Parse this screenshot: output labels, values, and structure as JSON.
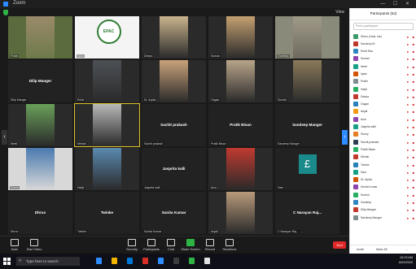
{
  "window": {
    "title": "Zoom"
  },
  "view_label": "View",
  "tiles": [
    {
      "name": "",
      "caption": "Prabh",
      "type": "video",
      "colors": [
        "#5a6b3d",
        "#9a8a6a",
        "#6e7a4a"
      ]
    },
    {
      "name": "",
      "caption": "Iqbal",
      "type": "logo",
      "logo_text": "EPAC",
      "colors": [
        "#ffffff"
      ]
    },
    {
      "name": "",
      "caption": "Deepa",
      "type": "video",
      "colors": [
        "#2a2a2a",
        "#c9b38c",
        "#2a2a2a"
      ]
    },
    {
      "name": "",
      "caption": "Suman",
      "type": "video",
      "colors": [
        "#2a2a2a",
        "#c4a070",
        "#2a2a2a"
      ]
    },
    {
      "name": "",
      "caption": "Gurdeep",
      "type": "video",
      "colors": [
        "#8a8a7a",
        "#a09a88",
        "#6e6a5e"
      ]
    },
    {
      "name": "Dilip Manger",
      "caption": "Dilip Manger",
      "type": "name"
    },
    {
      "name": "",
      "caption": "Rohit",
      "type": "video",
      "colors": [
        "#2a2a2a",
        "#4d5156",
        "#2a2a2a"
      ]
    },
    {
      "name": "",
      "caption": "Dr. Arpita",
      "type": "video",
      "colors": [
        "#2a2a2a",
        "#c9a27a",
        "#2a2a2a"
      ]
    },
    {
      "name": "",
      "caption": "Gagan",
      "type": "video",
      "colors": [
        "#2a2a2a",
        "#b9a58a",
        "#2a2a2a"
      ]
    },
    {
      "name": "",
      "caption": "Suresh",
      "type": "video",
      "colors": [
        "#2a2a2a",
        "#8a7a5a",
        "#2a2a2a"
      ]
    },
    {
      "name": "",
      "caption": "Neeti",
      "type": "video",
      "colors": [
        "#2a2a2a",
        "#6aa05a",
        "#2a2a2a"
      ]
    },
    {
      "name": "",
      "caption": "Mehak",
      "type": "video",
      "active": true,
      "colors": [
        "#2a2a2a",
        "#b8b8b8",
        "#2a2a2a"
      ]
    },
    {
      "name": "Sachit prakash",
      "caption": "Sachit prakash",
      "type": "name"
    },
    {
      "name": "Pratik Bisan",
      "caption": "Pratik Bisan",
      "type": "name"
    },
    {
      "name": "Sandeep Manger",
      "caption": "Sandeep Manger",
      "type": "name"
    },
    {
      "name": "",
      "caption": "Sunny",
      "type": "video",
      "colors": [
        "#d8d8d8",
        "#4a7ab0",
        "#d8d8d8"
      ]
    },
    {
      "name": "",
      "caption": "Harjit",
      "type": "video",
      "colors": [
        "#2a2a2a",
        "#5a8ab0",
        "#2a2a2a"
      ]
    },
    {
      "name": "Jasprita kalli",
      "caption": "Jasprita kalli",
      "type": "name"
    },
    {
      "name": "",
      "caption": "Arun",
      "type": "video",
      "colors": [
        "#2a2a2a",
        "#c03a30",
        "#2a2a2a"
      ]
    },
    {
      "name": "",
      "caption": "Sam",
      "type": "pound",
      "logo_text": "£"
    },
    {
      "name": "Dhruv",
      "caption": "Dhruv",
      "type": "name"
    },
    {
      "name": "Twinke",
      "caption": "Twinke",
      "type": "name"
    },
    {
      "name": "Sunita Kumar",
      "caption": "Sunita Kumar",
      "type": "name"
    },
    {
      "name": "",
      "caption": "Anjali",
      "type": "video",
      "colors": [
        "#2a2a2a",
        "#b89a7a",
        "#2a2a2a"
      ]
    },
    {
      "name": "C Narayan Raj...",
      "caption": "C Narayan Raj...",
      "type": "name"
    }
  ],
  "controls": [
    {
      "label": "Mute",
      "icon": "microphone-icon"
    },
    {
      "label": "Start Video",
      "icon": "video-camera-icon"
    },
    {
      "label": "Security",
      "icon": "shield-icon"
    },
    {
      "label": "Participants",
      "icon": "participants-icon"
    },
    {
      "label": "Chat",
      "icon": "chat-icon"
    },
    {
      "label": "Share Screen",
      "icon": "share-screen-icon",
      "accent": "#2fb344"
    },
    {
      "label": "Record",
      "icon": "record-icon"
    },
    {
      "label": "Reactions",
      "icon": "smiley-icon"
    }
  ],
  "end_label": "End",
  "panel": {
    "title": "Participants (52)",
    "search_placeholder": "Find a participant",
    "participants": [
      {
        "name": "Dhruv (Host, me)",
        "color": "#3a9a6a"
      },
      {
        "name": "Sandeep M",
        "color": "#c0392b"
      },
      {
        "name": "Rohit Rao",
        "color": "#2e86c1"
      },
      {
        "name": "Suman",
        "color": "#8e44ad"
      },
      {
        "name": "Neeti",
        "color": "#16a085"
      },
      {
        "name": "Iqbal",
        "color": "#d35400"
      },
      {
        "name": "Prabh",
        "color": "#7f8c8d"
      },
      {
        "name": "Harjit",
        "color": "#27ae60"
      },
      {
        "name": "Deepa",
        "color": "#c0392b"
      },
      {
        "name": "Gagan",
        "color": "#2980b9"
      },
      {
        "name": "Anjali",
        "color": "#f39c12"
      },
      {
        "name": "Arun",
        "color": "#8e44ad"
      },
      {
        "name": "Jasprita kalli",
        "color": "#16a085"
      },
      {
        "name": "Sunny",
        "color": "#e67e22"
      },
      {
        "name": "Sachit prakash",
        "color": "#2c3e50"
      },
      {
        "name": "Pratik Bisan",
        "color": "#27ae60"
      },
      {
        "name": "Mehak",
        "color": "#c0392b"
      },
      {
        "name": "Twinke",
        "color": "#2980b9"
      },
      {
        "name": "Sam",
        "color": "#16a085"
      },
      {
        "name": "Dr. Arpita",
        "color": "#d35400"
      },
      {
        "name": "Sunita Kumar",
        "color": "#8e44ad"
      },
      {
        "name": "Suresh",
        "color": "#27ae60"
      },
      {
        "name": "Gurdeep",
        "color": "#2e86c1"
      },
      {
        "name": "Dilip Manger",
        "color": "#c0392b"
      },
      {
        "name": "Sandeep Manger",
        "color": "#7f8c8d"
      }
    ],
    "invite_label": "Invite",
    "mute_all_label": "Mute All",
    "more_label": "..."
  },
  "taskbar": {
    "search_placeholder": "Type here to search",
    "time": "10:23 AM",
    "date": "8/20/2020",
    "apps": [
      "#2d8cff",
      "#f4b400",
      "#0078d7",
      "#d93025",
      "#2d8cff",
      "#3c3c3c",
      "#2fb344",
      "#e2e2e2"
    ]
  }
}
